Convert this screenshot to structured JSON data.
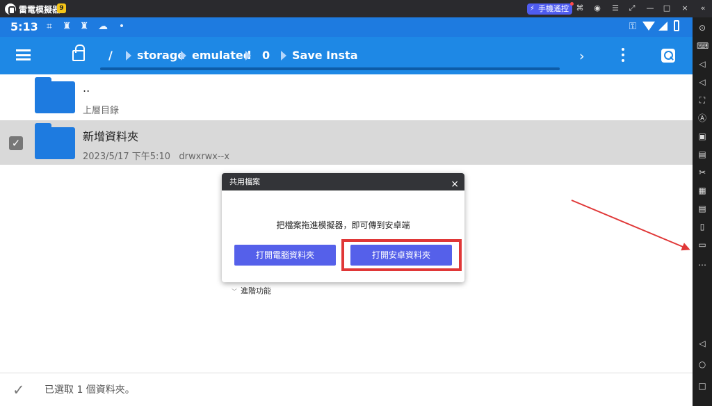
{
  "window": {
    "app_title": "雷電模擬器",
    "badge": "9",
    "remote_button": "手機遙控"
  },
  "status": {
    "time": "5:13"
  },
  "toolbar": {
    "root": "/",
    "crumbs": [
      "storage",
      "emulated",
      "0",
      "Save Insta"
    ]
  },
  "files": [
    {
      "name": "..",
      "sub": "上層目錄"
    },
    {
      "name": "新增資料夾",
      "date": "2023/5/17 下午5:10",
      "permissions": "drwxrwx--x"
    }
  ],
  "dialog": {
    "title": "共用檔案",
    "message": "把檔案拖進模擬器，即可傳到安卓端",
    "pc_button": "打開電腦資料夾",
    "android_button": "打開安卓資料夾",
    "advanced": "進階功能"
  },
  "bottom": {
    "selected": "已選取 1 個資料夾。"
  },
  "colors": {
    "status_bar": "#1e7be0",
    "toolbar": "#1e88e5",
    "dialog_header": "#333438",
    "accent_button": "#5560ea",
    "highlight": "#e03737"
  }
}
